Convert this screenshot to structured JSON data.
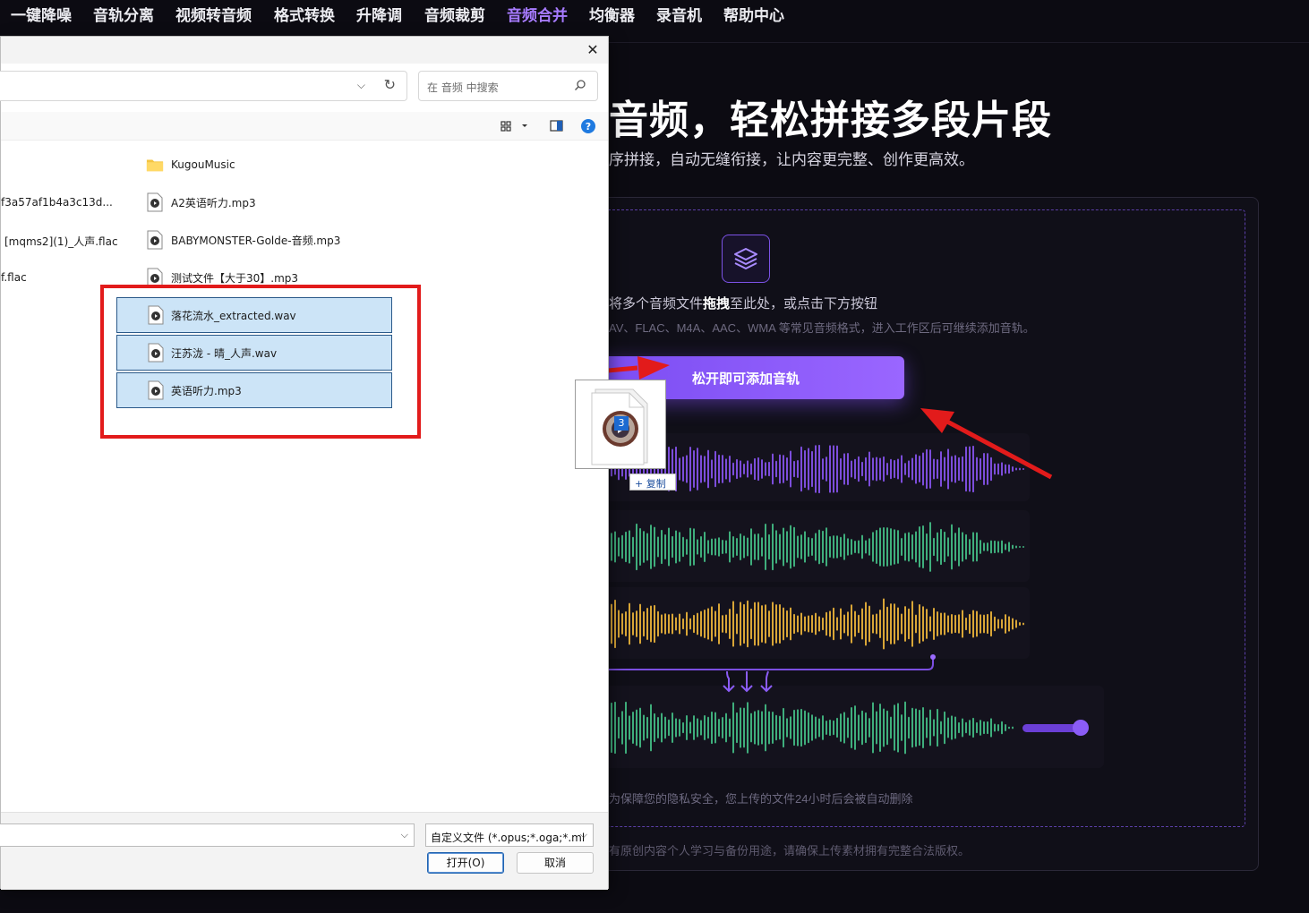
{
  "nav": {
    "items": [
      {
        "label": "一键降噪",
        "active": false
      },
      {
        "label": "音轨分离",
        "active": false
      },
      {
        "label": "视频转音频",
        "active": false
      },
      {
        "label": "格式转换",
        "active": false
      },
      {
        "label": "升降调",
        "active": false
      },
      {
        "label": "音频裁剪",
        "active": false
      },
      {
        "label": "音频合并",
        "active": true
      },
      {
        "label": "均衡器",
        "active": false
      },
      {
        "label": "录音机",
        "active": false
      },
      {
        "label": "帮助中心",
        "active": false
      }
    ]
  },
  "hero": {
    "title": "音频，轻松拼接多段片段",
    "subtitle": "序拼接，自动无缝衔接，让内容更完整、创作更高效。"
  },
  "upload": {
    "drop_prefix": "将多个音频文件",
    "drop_bold": "拖拽",
    "drop_suffix": "至此处，或点击下方按钮",
    "hint": "AV、FLAC、M4A、AAC、WMA 等常见音频格式，进入工作区后可继续添加音轨。",
    "button": "松开即可添加音轨",
    "privacy": "为保障您的隐私安全，您上传的文件24小时后会被自动删除",
    "footer": "有原创内容个人学习与备份用途，请确保上传素材拥有完整合法版权。"
  },
  "dialog": {
    "search_placeholder": "在 音频 中搜索",
    "left_column": [
      "f3a57af1b4a3c13d...",
      "[mqms2](1)_人声.flac",
      "f.flac"
    ],
    "files": [
      {
        "name": "KugouMusic",
        "type": "folder"
      },
      {
        "name": "A2英语听力.mp3",
        "type": "audio"
      },
      {
        "name": "BABYMONSTER-Golde-音频.mp3",
        "type": "audio"
      },
      {
        "name": "测试文件【大于30】.mp3",
        "type": "audio"
      }
    ],
    "selected": [
      {
        "name": "落花流水_extracted.wav"
      },
      {
        "name": "汪苏泷 - 晴_人声.wav"
      },
      {
        "name": "英语听力.mp3"
      }
    ],
    "filter": "自定义文件 (*.opus;*.oga;*.ml",
    "open_button": "打开(O)",
    "cancel_button": "取消"
  },
  "drag": {
    "count": "3",
    "action": "+ 复制"
  },
  "colors": {
    "accent": "#8b5cf6",
    "wave_purple": "#7c4ddb",
    "wave_green": "#3fae7c",
    "wave_yellow": "#d9a637",
    "annotation_red": "#e21b1b"
  }
}
